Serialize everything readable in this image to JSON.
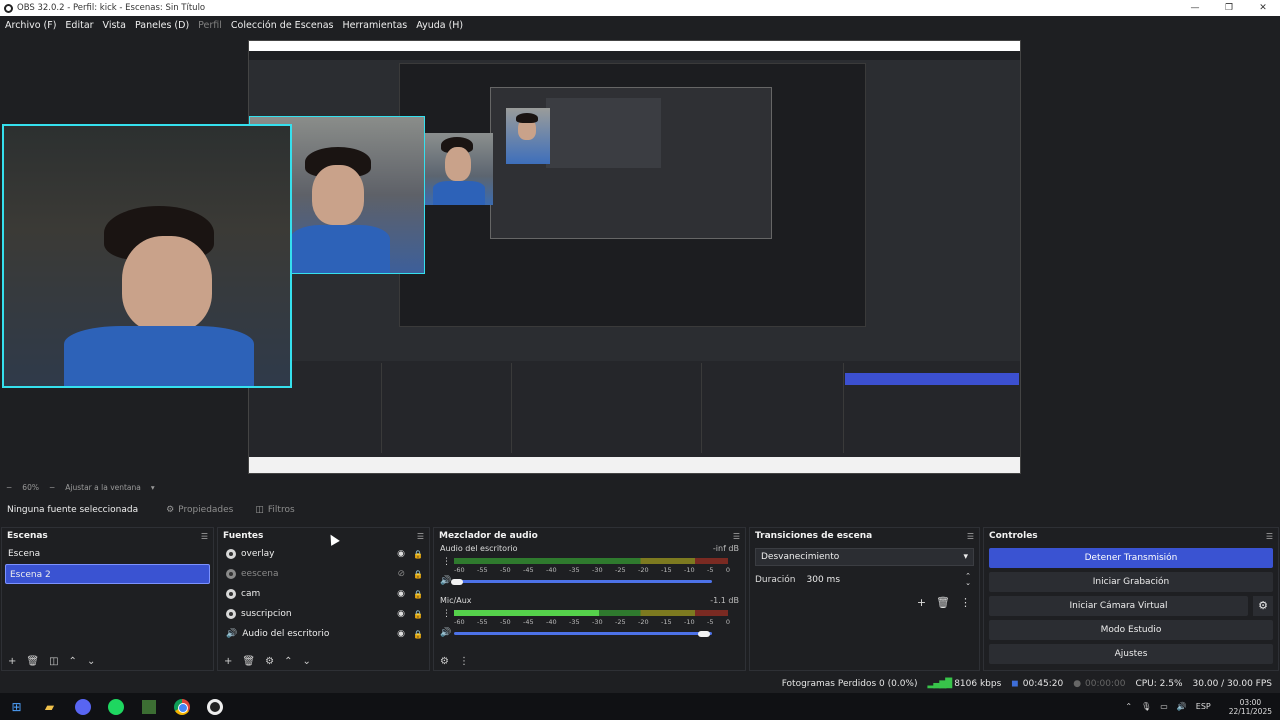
{
  "window": {
    "title": "OBS 32.0.2 - Perfil: kick - Escenas: Sin Título",
    "minimize": "—",
    "maximize": "❐",
    "close": "✕"
  },
  "menu": [
    "Archivo (F)",
    "Editar",
    "Vista",
    "Paneles (D)",
    "Perfil",
    "Colección de Escenas",
    "Herramientas",
    "Ayuda (H)"
  ],
  "zoom": {
    "minus": "−",
    "value": "60%",
    "minus2": "−",
    "fit": "Ajustar a la ventana",
    "arrow": "▾"
  },
  "props_bar": {
    "no_source": "Ninguna fuente seleccionada",
    "properties": "Propiedades",
    "filters": "Filtros"
  },
  "scenes": {
    "title": "Escenas",
    "items": [
      "Escena",
      "Escena 2"
    ],
    "selected": "Escena 2"
  },
  "sources": {
    "title": "Fuentes",
    "items": [
      {
        "name": "overlay",
        "type": "browser",
        "visible": true
      },
      {
        "name": "eescena",
        "type": "browser",
        "visible": false
      },
      {
        "name": "cam",
        "type": "camera",
        "visible": true
      },
      {
        "name": "suscripcion",
        "type": "browser",
        "visible": true
      },
      {
        "name": "Audio del escritorio",
        "type": "audio",
        "visible": true
      }
    ]
  },
  "mixer": {
    "title": "Mezclador de audio",
    "ticks": [
      "-60",
      "-55",
      "-50",
      "-45",
      "-40",
      "-35",
      "-30",
      "-25",
      "-20",
      "-15",
      "-10",
      "-5",
      "0"
    ],
    "channels": [
      {
        "name": "Audio del escritorio",
        "db": "-inf dB",
        "level": 0,
        "volume": 0.01
      },
      {
        "name": "Mic/Aux",
        "db": "-1.1 dB",
        "level": 0.53,
        "volume": 0.97
      }
    ]
  },
  "transitions": {
    "title": "Transiciones de escena",
    "selected": "Desvanecimiento",
    "duration_label": "Duración",
    "duration_value": "300 ms"
  },
  "controls": {
    "title": "Controles",
    "buttons": [
      "Detener Transmisión",
      "Iniciar Grabación",
      "Iniciar Cámara Virtual",
      "Modo Estudio",
      "Ajustes"
    ]
  },
  "status": {
    "dropped": "Fotogramas Perdidos 0 (0.0%)",
    "bitrate": "8106 kbps",
    "stream_time": "00:45:20",
    "rec_time": "00:00:00",
    "cpu": "CPU: 2.5%",
    "fps": "30.00 / 30.00 FPS"
  },
  "taskbar": {
    "lang": "ESP",
    "time": "03:00",
    "date": "22/11/2025"
  },
  "colors": {
    "accent": "#3a53d2",
    "webcam_border": "#35e0ee",
    "meter_green": "#2f7a2e",
    "meter_yellow": "#7d7a20",
    "meter_red": "#7a2a22"
  }
}
